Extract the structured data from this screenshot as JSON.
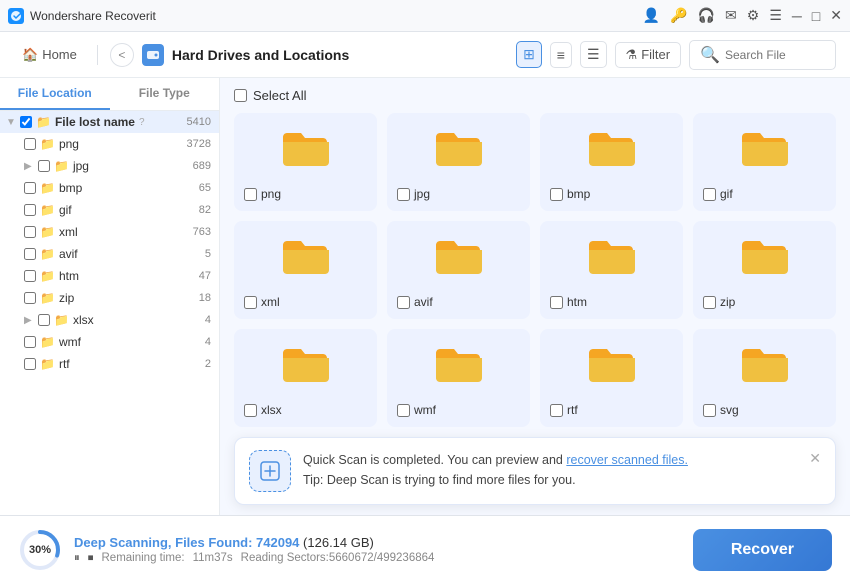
{
  "app": {
    "name": "Wondershare Recoverit",
    "logo_color": "#1890ff"
  },
  "titlebar": {
    "title": "Wondershare Recoverit",
    "icons": [
      "person-icon",
      "key-icon",
      "headset-icon",
      "mail-icon",
      "settings-icon",
      "menu-icon"
    ],
    "win_controls": [
      "minimize-icon",
      "maximize-icon",
      "close-icon"
    ]
  },
  "header": {
    "home_label": "Home",
    "back_label": "<",
    "breadcrumb_icon": "hdd-icon",
    "breadcrumb_text": "Hard Drives and Locations",
    "view_grid_label": "⊞",
    "view_list_label": "≡",
    "view_compact_label": "☰",
    "filter_label": "Filter",
    "search_placeholder": "Search File"
  },
  "sidebar": {
    "tab_location": "File Location",
    "tab_type": "File Type",
    "items": [
      {
        "id": "file-lost-name",
        "label": "File lost name",
        "count": "5410",
        "level": 0,
        "has_toggle": true,
        "selected": true
      },
      {
        "id": "png",
        "label": "png",
        "count": "3728",
        "level": 1,
        "has_toggle": false
      },
      {
        "id": "jpg",
        "label": "jpg",
        "count": "689",
        "level": 1,
        "has_toggle": true
      },
      {
        "id": "bmp",
        "label": "bmp",
        "count": "65",
        "level": 1,
        "has_toggle": false
      },
      {
        "id": "gif",
        "label": "gif",
        "count": "82",
        "level": 1,
        "has_toggle": false
      },
      {
        "id": "xml",
        "label": "xml",
        "count": "763",
        "level": 1,
        "has_toggle": false
      },
      {
        "id": "avif",
        "label": "avif",
        "count": "5",
        "level": 1,
        "has_toggle": false
      },
      {
        "id": "htm",
        "label": "htm",
        "count": "47",
        "level": 1,
        "has_toggle": false
      },
      {
        "id": "zip",
        "label": "zip",
        "count": "18",
        "level": 1,
        "has_toggle": false
      },
      {
        "id": "xlsx",
        "label": "xlsx",
        "count": "4",
        "level": 1,
        "has_toggle": true
      },
      {
        "id": "wmf",
        "label": "wmf",
        "count": "4",
        "level": 1,
        "has_toggle": false
      },
      {
        "id": "rtf",
        "label": "rtf",
        "count": "2",
        "level": 1,
        "has_toggle": false
      }
    ]
  },
  "grid": {
    "select_all": "Select All",
    "items": [
      {
        "label": "png"
      },
      {
        "label": "jpg"
      },
      {
        "label": "bmp"
      },
      {
        "label": "gif"
      },
      {
        "label": "xml"
      },
      {
        "label": "avif"
      },
      {
        "label": "htm"
      },
      {
        "label": "zip"
      },
      {
        "label": "xlsx"
      },
      {
        "label": "wmf"
      },
      {
        "label": "rtf"
      },
      {
        "label": "svg"
      }
    ]
  },
  "notification": {
    "text_before": "Quick Scan is completed. You can preview and ",
    "link_text": "recover scanned files.",
    "tip": "Tip: Deep Scan is trying to find more files for you."
  },
  "footer": {
    "progress_percent": 30,
    "scan_label": "Deep Scanning, Files Found:",
    "file_count": "742094",
    "file_size": "(126.14 GB)",
    "remaining_label": "Remaining time:",
    "remaining_time": "11m37s",
    "reading_label": "Reading Sectors:5660672/499236864",
    "recover_label": "Recover"
  }
}
